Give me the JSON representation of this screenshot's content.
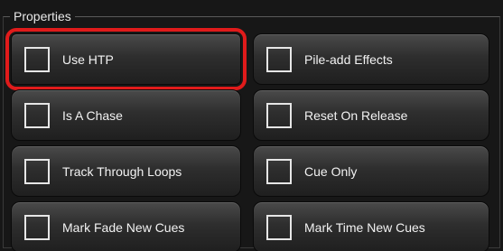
{
  "group": {
    "title": "Properties"
  },
  "options": [
    {
      "label": "Use HTP",
      "checked": false,
      "highlighted": true
    },
    {
      "label": "Pile-add Effects",
      "checked": false,
      "highlighted": false
    },
    {
      "label": "Is A Chase",
      "checked": false,
      "highlighted": false
    },
    {
      "label": "Reset On Release",
      "checked": false,
      "highlighted": false
    },
    {
      "label": "Track Through Loops",
      "checked": false,
      "highlighted": false
    },
    {
      "label": "Cue Only",
      "checked": false,
      "highlighted": false
    },
    {
      "label": "Mark Fade New Cues",
      "checked": false,
      "highlighted": false
    },
    {
      "label": "Mark Time New Cues",
      "checked": false,
      "highlighted": false
    }
  ],
  "colors": {
    "highlight": "#e01b1b",
    "panel_bg": "#171717",
    "text": "#f2f2f2"
  }
}
